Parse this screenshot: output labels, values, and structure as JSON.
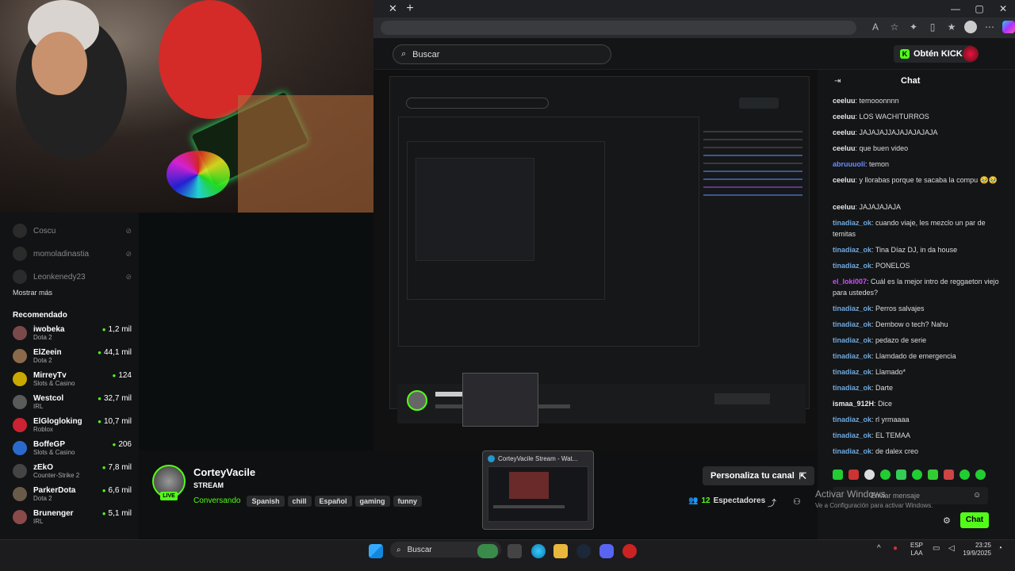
{
  "browser": {
    "newtab_symbol": "+",
    "window_controls": [
      "—",
      "▢",
      "✕"
    ]
  },
  "header": {
    "search_placeholder": "Buscar",
    "get_kicks": "Obtén KICKs"
  },
  "sidebar": {
    "followed": [
      {
        "name": "Coscu"
      },
      {
        "name": "momoladinastia"
      },
      {
        "name": "Leonkenedy23"
      }
    ],
    "show_more": "Mostrar más",
    "recommended_title": "Recomendado",
    "recommended": [
      {
        "name": "iwobeka",
        "category": "Dota 2",
        "viewers": "1,2 mil",
        "color": "#7a4a4a"
      },
      {
        "name": "ElZeein",
        "category": "Dota 2",
        "viewers": "44,1 mil",
        "color": "#8a6a4a"
      },
      {
        "name": "MirreyTv",
        "category": "Slots & Casino",
        "viewers": "124",
        "color": "#c9a800"
      },
      {
        "name": "Westcol",
        "category": "IRL",
        "viewers": "32,7 mil",
        "color": "#5a5a5a"
      },
      {
        "name": "ElGlogloking",
        "category": "Roblox",
        "viewers": "10,7 mil",
        "color": "#c23"
      },
      {
        "name": "BoffeGP",
        "category": "Slots & Casino",
        "viewers": "206",
        "color": "#2a6acc"
      },
      {
        "name": "zEkO",
        "category": "Counter-Strike 2",
        "viewers": "7,8 mil",
        "color": "#444"
      },
      {
        "name": "ParkerDota",
        "category": "Dota 2",
        "viewers": "6,6 mil",
        "color": "#6a5a4a"
      },
      {
        "name": "Brunenger",
        "category": "IRL",
        "viewers": "5,1 mil",
        "color": "#8a4a4a"
      }
    ]
  },
  "stream": {
    "name": "CorteyVacile",
    "title": "STREAM",
    "live": "LIVE",
    "category": "Conversando",
    "tags": [
      "Spanish",
      "chill",
      "Español",
      "gaming",
      "funny"
    ],
    "customize": "Personaliza tu canal",
    "viewers_count": "12",
    "viewers_label": "Espectadores"
  },
  "chat": {
    "title": "Chat",
    "messages": [
      {
        "user": "ceeluu",
        "text": "temooonnnn",
        "color": "#e8e8e8"
      },
      {
        "user": "ceeluu",
        "text": "LOS WACHITURROS",
        "color": "#e8e8e8"
      },
      {
        "user": "ceeluu",
        "text": "JAJAJAJJAJAJAJAJAJA",
        "color": "#e8e8e8"
      },
      {
        "user": "ceeluu",
        "text": "que buen video",
        "color": "#e8e8e8"
      },
      {
        "user": "abruuuoli",
        "text": "temon",
        "color": "#6a8cff"
      },
      {
        "user": "ceeluu",
        "text": "y llorabas porque te sacaba la compu 🥹🥹",
        "color": "#e8e8e8"
      },
      {
        "user": "ceeluu",
        "text": "JAJAJAJAJA",
        "color": "#e8e8e8"
      },
      {
        "user": "tinadiaz_ok",
        "text": "cuando viaje, les mezclo un par de temitas",
        "color": "#6fa8dc"
      },
      {
        "user": "tinadiaz_ok",
        "text": "Tina Díaz DJ, in da house",
        "color": "#6fa8dc"
      },
      {
        "user": "tinadiaz_ok",
        "text": "PONELOS",
        "color": "#6fa8dc"
      },
      {
        "user": "el_loki007",
        "text": "Cuál es la mejor intro de reggaeton viejo para ustedes?",
        "color": "#d04cff"
      },
      {
        "user": "tinadiaz_ok",
        "text": "Perros salvajes",
        "color": "#6fa8dc"
      },
      {
        "user": "tinadiaz_ok",
        "text": "Dembow o tech? Nahu",
        "color": "#6fa8dc"
      },
      {
        "user": "tinadiaz_ok",
        "text": "pedazo de serie",
        "color": "#6fa8dc"
      },
      {
        "user": "tinadiaz_ok",
        "text": "Llamdado de emergencia",
        "color": "#6fa8dc"
      },
      {
        "user": "tinadiaz_ok",
        "text": "Llamado*",
        "color": "#6fa8dc"
      },
      {
        "user": "tinadiaz_ok",
        "text": "Darte",
        "color": "#6fa8dc"
      },
      {
        "user": "ismaa_912H",
        "text": "Dice",
        "color": "#e8e8e8"
      },
      {
        "user": "tinadiaz_ok",
        "text": "rl yrmaaaa",
        "color": "#6fa8dc"
      },
      {
        "user": "tinadiaz_ok",
        "text": "EL TEMAA",
        "color": "#6fa8dc"
      },
      {
        "user": "tinadiaz_ok",
        "text": "de dalex creo",
        "color": "#6fa8dc"
      }
    ],
    "input_placeholder": "Enviar mensaje",
    "send_button": "Chat"
  },
  "windows_watermark": {
    "line1": "Activar Windows",
    "line2": "Ve a Configuración para activar Windows."
  },
  "taskbar": {
    "search": "Buscar",
    "thumbnail_title": "CorteyVacile Stream - Wat...",
    "lang": "ESP",
    "region": "LAA",
    "time": "23:25",
    "date": "19/9/2025"
  },
  "colors": {
    "kick_green": "#53fc18",
    "background": "#0b0e0f"
  }
}
